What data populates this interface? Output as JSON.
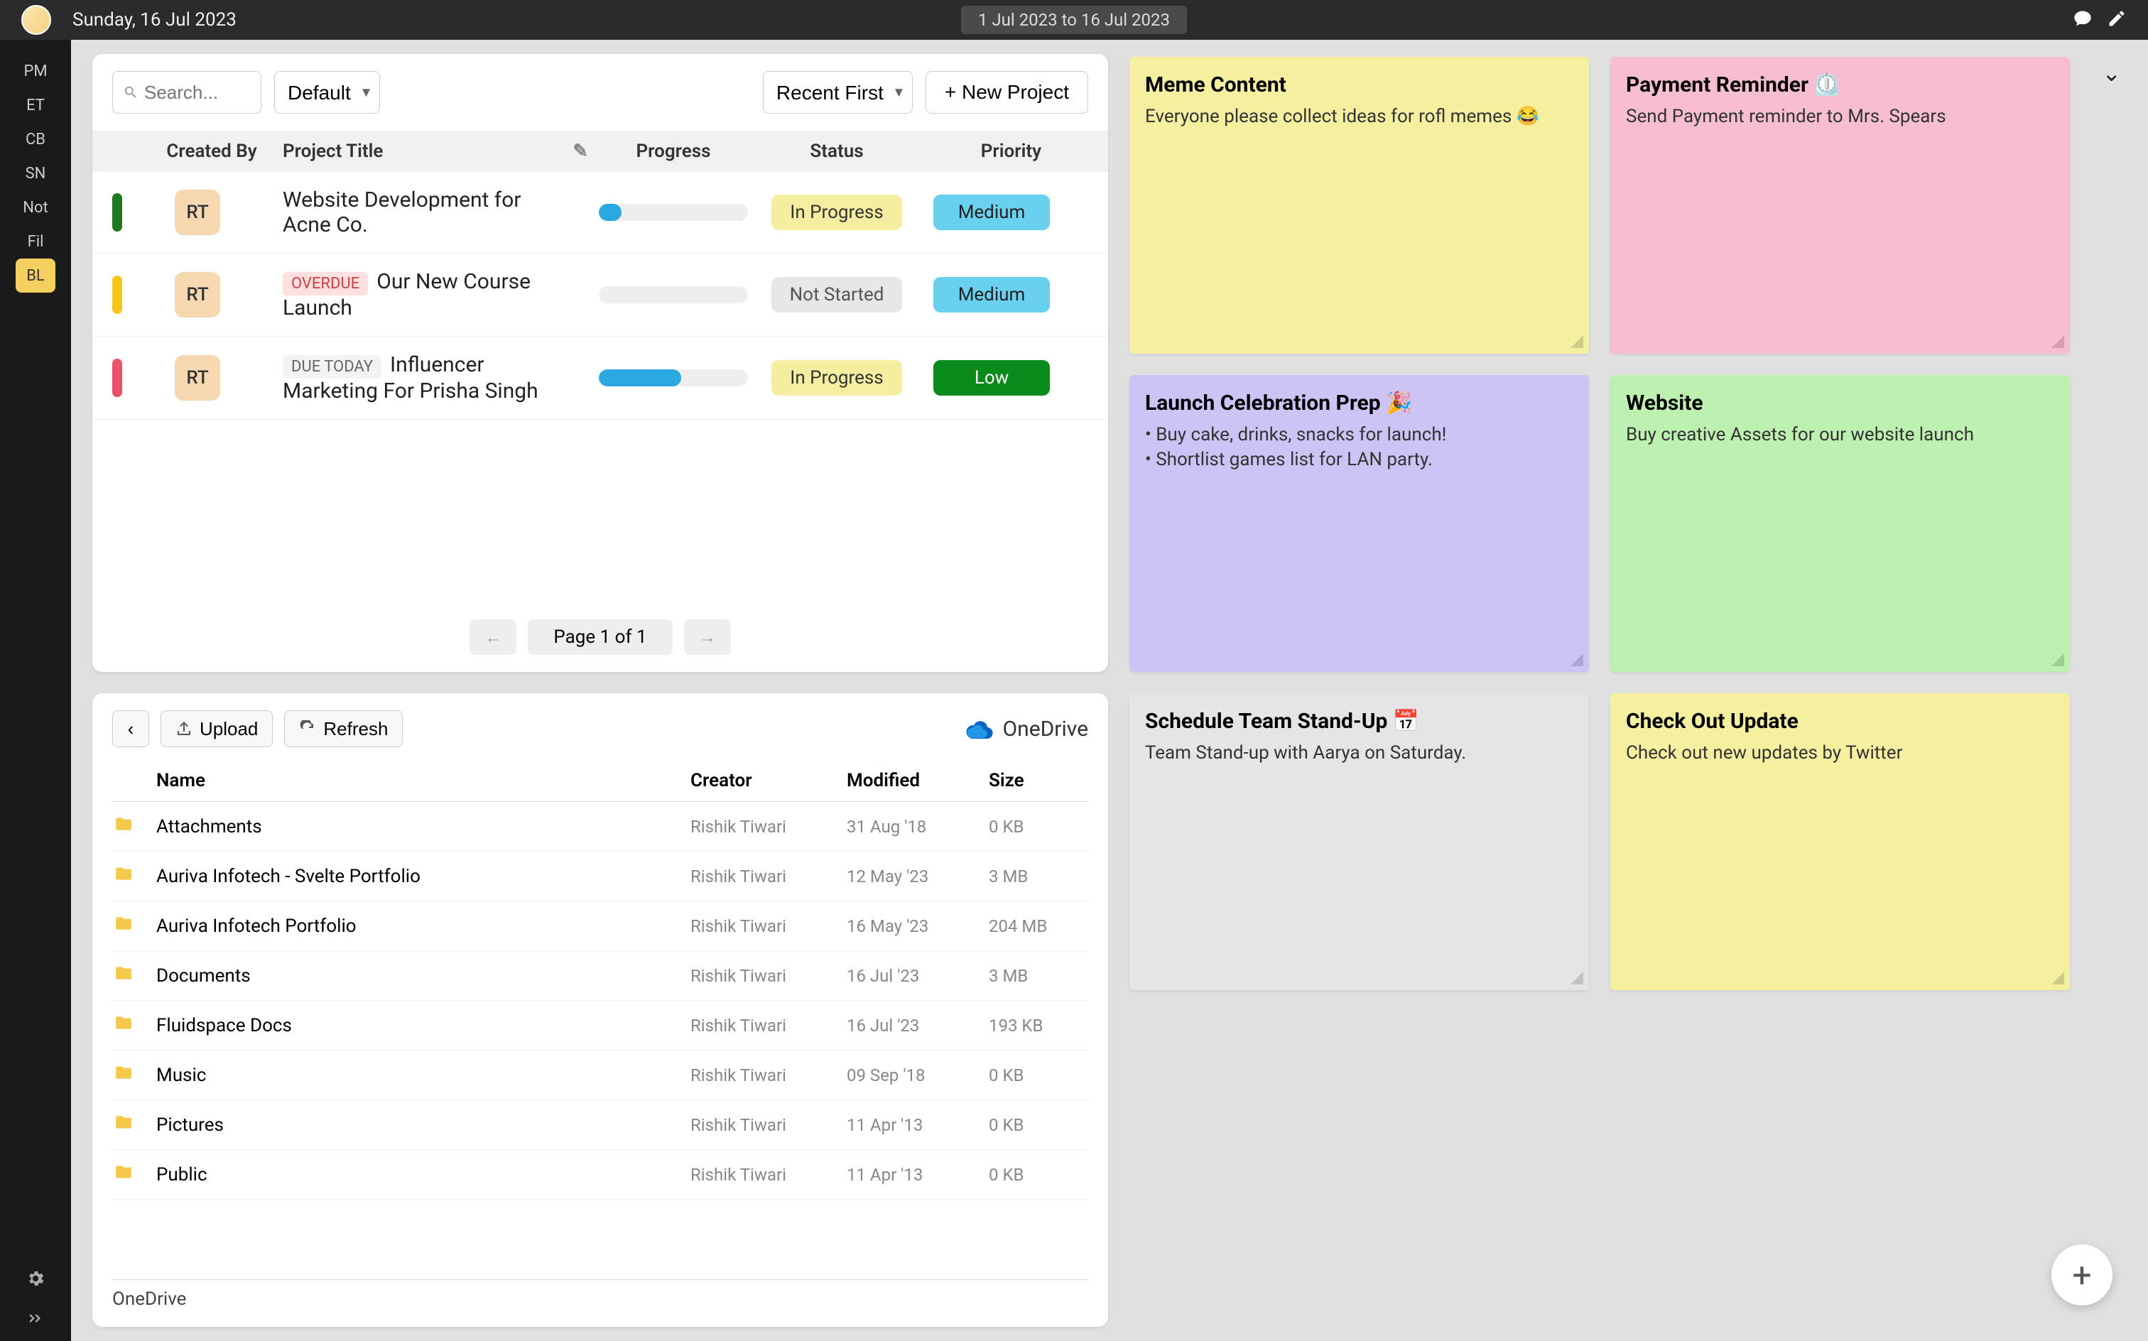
{
  "topbar": {
    "date": "Sunday, 16 Jul 2023",
    "range": "1 Jul 2023 to 16 Jul 2023"
  },
  "sidebar": {
    "items": [
      "PM",
      "ET",
      "CB",
      "SN",
      "Not",
      "Fil",
      "BL"
    ],
    "activeIndex": 6
  },
  "projects": {
    "searchPlaceholder": "Search...",
    "defaultFilter": "Default",
    "sortBy": "Recent First",
    "newProjectLabel": "+ New Project",
    "columns": {
      "createdBy": "Created By",
      "title": "Project Title",
      "progress": "Progress",
      "status": "Status",
      "priority": "Priority"
    },
    "rows": [
      {
        "indicator": "green",
        "creator": "RT",
        "title": "Website Development for Acne Co.",
        "tag": "",
        "progress": 15,
        "status": "In Progress",
        "statusClass": "inprog",
        "priority": "Medium",
        "prioClass": "med"
      },
      {
        "indicator": "yellow",
        "creator": "RT",
        "title": "Our New Course Launch",
        "tag": "OVERDUE",
        "tagClass": "overdue",
        "progress": 0,
        "status": "Not Started",
        "statusClass": "notstart",
        "priority": "Medium",
        "prioClass": "med"
      },
      {
        "indicator": "red",
        "creator": "RT",
        "title": "Influencer Marketing For Prisha Singh",
        "tag": "DUE TODAY",
        "tagClass": "duetoday",
        "progress": 55,
        "status": "In Progress",
        "statusClass": "inprog",
        "priority": "Low",
        "prioClass": "low"
      }
    ],
    "pagination": {
      "prev": "←",
      "label": "Page 1 of 1",
      "next": "→"
    }
  },
  "files": {
    "back": "‹",
    "upload": "Upload",
    "refresh": "Refresh",
    "provider": "OneDrive",
    "columns": {
      "name": "Name",
      "creator": "Creator",
      "modified": "Modified",
      "size": "Size"
    },
    "rows": [
      {
        "name": "Attachments",
        "creator": "Rishik Tiwari",
        "modified": "31 Aug '18",
        "size": "0 KB"
      },
      {
        "name": "Auriva Infotech - Svelte Portfolio",
        "creator": "Rishik Tiwari",
        "modified": "12 May '23",
        "size": "3 MB"
      },
      {
        "name": "Auriva Infotech Portfolio",
        "creator": "Rishik Tiwari",
        "modified": "16 May '23",
        "size": "204 MB"
      },
      {
        "name": "Documents",
        "creator": "Rishik Tiwari",
        "modified": "16 Jul '23",
        "size": "3 MB"
      },
      {
        "name": "Fluidspace Docs",
        "creator": "Rishik Tiwari",
        "modified": "16 Jul '23",
        "size": "193 KB"
      },
      {
        "name": "Music",
        "creator": "Rishik Tiwari",
        "modified": "09 Sep '18",
        "size": "0 KB"
      },
      {
        "name": "Pictures",
        "creator": "Rishik Tiwari",
        "modified": "11 Apr '13",
        "size": "0 KB"
      },
      {
        "name": "Public",
        "creator": "Rishik Tiwari",
        "modified": "11 Apr '13",
        "size": "0 KB"
      }
    ],
    "breadcrumb": "OneDrive"
  },
  "notes": [
    {
      "title": "Meme Content",
      "body": "Everyone please collect ideas for rofl memes 😂",
      "color": "yellow"
    },
    {
      "title": "Payment Reminder ⏲️",
      "body": "Send Payment reminder to Mrs. Spears",
      "color": "pink"
    },
    {
      "title": "Launch Celebration Prep 🎉",
      "body": "• Buy cake, drinks, snacks for launch!\n• Shortlist games list for LAN party.",
      "color": "purple"
    },
    {
      "title": "Website",
      "body": "Buy creative Assets for our website launch",
      "color": "green"
    },
    {
      "title": "Schedule Team Stand-Up 📅",
      "body": "Team Stand-up with Aarya on Saturday.",
      "color": "grey"
    },
    {
      "title": "Check Out Update",
      "body": "Check out new updates by Twitter",
      "color": "yellow2"
    }
  ]
}
